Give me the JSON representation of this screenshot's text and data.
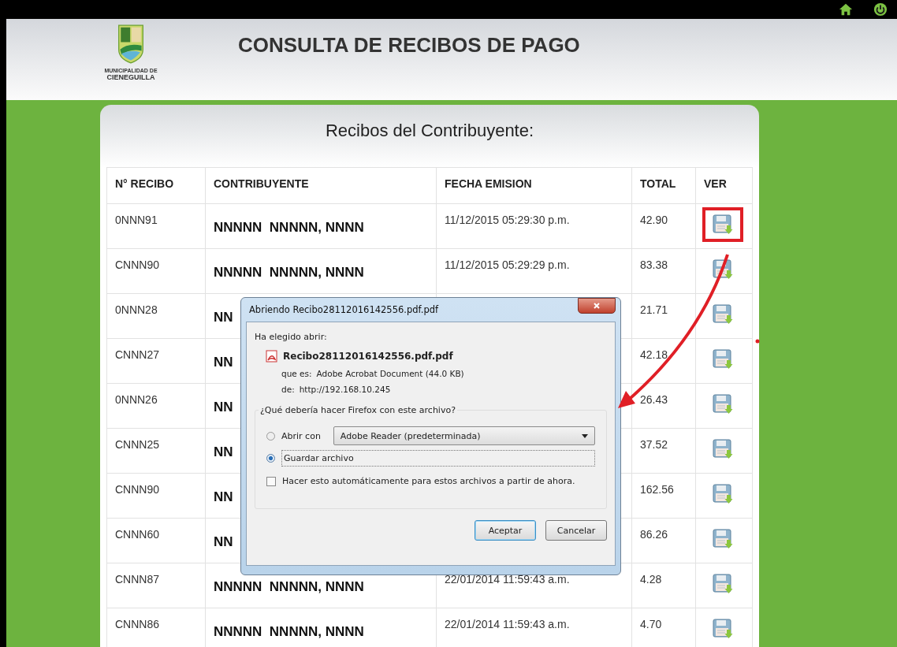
{
  "header": {
    "logo_caption": [
      "MUNICIPALIDAD DE",
      "CIENEGUILLA"
    ],
    "title": "CONSULTA DE RECIBOS DE PAGO"
  },
  "panel": {
    "title": "Recibos del Contribuyente:",
    "table": {
      "columns": [
        "N° RECIBO",
        "CONTRIBUYENTE",
        "FECHA EMISION",
        "TOTAL",
        "VER"
      ],
      "rows": [
        {
          "receipt": "0NNN91",
          "contributor": "NNNNN  NNNNN, NNNN",
          "date": "11/12/2015 05:29:30 p.m.",
          "total": "42.90",
          "highlighted": true
        },
        {
          "receipt": "CNNN90",
          "contributor": "NNNNN  NNNNN, NNNN",
          "date": "11/12/2015 05:29:29 p.m.",
          "total": "83.38",
          "highlighted": false
        },
        {
          "receipt": "0NNN28",
          "contributor": "NN",
          "total": "21.71",
          "highlighted": false
        },
        {
          "receipt": "CNNN27",
          "contributor": "NN",
          "total": "42.18",
          "highlighted": false
        },
        {
          "receipt": "0NNN26",
          "contributor": "NN",
          "total": "26.43",
          "highlighted": false
        },
        {
          "receipt": "CNNN25",
          "contributor": "NN",
          "total": "37.52",
          "highlighted": false
        },
        {
          "receipt": "CNNN90",
          "contributor": "NN",
          "total": "162.56",
          "highlighted": false
        },
        {
          "receipt": "CNNN60",
          "contributor": "NN",
          "total": "86.26",
          "highlighted": false
        },
        {
          "receipt": "CNNN87",
          "contributor": "NNNNN  NNNNN, NNNN",
          "date": "22/01/2014 11:59:43 a.m.",
          "total": "4.28",
          "highlighted": false
        },
        {
          "receipt": "CNNN86",
          "contributor": "NNNNN  NNNNN, NNNN",
          "date": "22/01/2014 11:59:43 a.m.",
          "total": "4.70",
          "highlighted": false
        }
      ]
    }
  },
  "dialog": {
    "title": "Abriendo Recibo28112016142556.pdf.pdf",
    "intro": "Ha elegido abrir:",
    "file_name": "Recibo28112016142556.pdf.pdf",
    "type_label": "que es:",
    "type_value": "Adobe Acrobat Document (44.0 KB)",
    "from_label": "de:",
    "from_value": "http://192.168.10.245",
    "question": "¿Qué debería hacer Firefox con este archivo?",
    "options": [
      {
        "kind": "open",
        "label": "Abrir con",
        "selected": false,
        "app": "Adobe Reader  (predeterminada)"
      },
      {
        "kind": "save",
        "label": "Guardar archivo",
        "selected": true
      }
    ],
    "remember": {
      "label": "Hacer esto automáticamente para estos archivos a partir de ahora.",
      "checked": false
    },
    "buttons": [
      {
        "label": "Aceptar",
        "default": true
      },
      {
        "label": "Cancelar",
        "default": false
      }
    ]
  }
}
